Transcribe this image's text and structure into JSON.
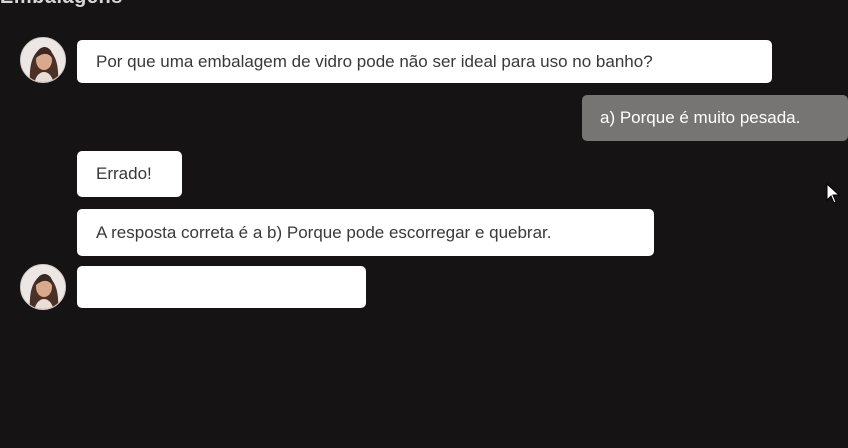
{
  "header": {
    "title": "Embalagens"
  },
  "chat": {
    "question": "Por que uma embalagem de vidro pode não ser ideal para uso no banho?",
    "user_answer": "a) Porque é muito pesada.",
    "feedback": "Errado!",
    "correction": "A resposta correta é a b) Porque pode escorregar e quebrar.",
    "pending": ""
  },
  "colors": {
    "background": "#151314",
    "bot_bubble": "#ffffff",
    "user_bubble": "#777474"
  }
}
